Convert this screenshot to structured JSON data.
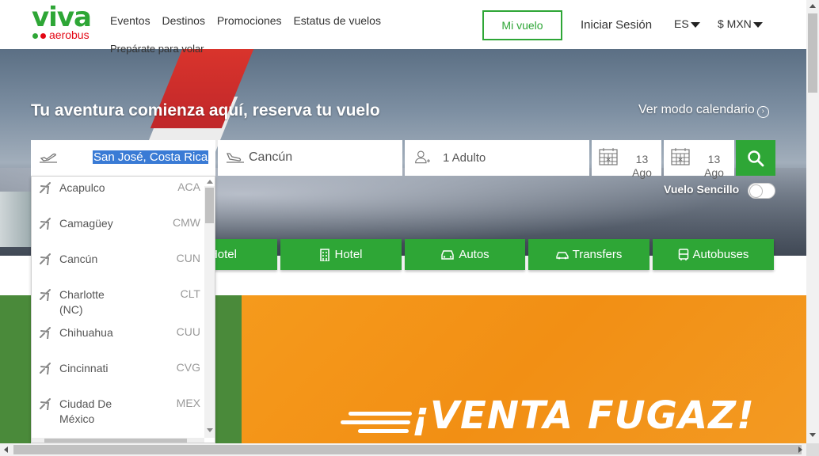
{
  "brand": {
    "name": "viva",
    "sub": "aerobus",
    "green": "#2ea636",
    "red": "#e30613",
    "orange": "#f39a22"
  },
  "nav": {
    "items": [
      "Eventos",
      "Destinos",
      "Promociones",
      "Estatus de vuelos"
    ],
    "second_line": "Prepárate para volar",
    "my_flight": "Mi vuelo",
    "login": "Iniciar Sesión",
    "language": "ES",
    "currency": "$ MXN"
  },
  "hero": {
    "title": "Tu aventura comienza aquí, reserva tu vuelo",
    "calendar_link": "Ver modo calendario",
    "calendar_icon": "chevron-right-circle-icon"
  },
  "search": {
    "origin": "San José, Costa Rica",
    "destination": "Cancún",
    "passengers": "1 Adulto",
    "depart_day": "13",
    "depart_month": "Ago",
    "return_day": "13",
    "return_month": "Ago",
    "one_way_label": "Vuelo Sencillo"
  },
  "products": [
    {
      "label": "+ Hotel",
      "icon": "plane-hotel-icon"
    },
    {
      "label": "Hotel",
      "icon": "building-icon"
    },
    {
      "label": "Autos",
      "icon": "car-icon"
    },
    {
      "label": "Transfers",
      "icon": "shuttle-icon"
    },
    {
      "label": "Autobuses",
      "icon": "bus-icon"
    }
  ],
  "dropdown": {
    "items": [
      {
        "city": "Acapulco",
        "code": "ACA"
      },
      {
        "city": "Camagüey",
        "code": "CMW"
      },
      {
        "city": "Cancún",
        "code": "CUN"
      },
      {
        "city": "Charlotte (NC)",
        "code": "CLT"
      },
      {
        "city": "Chihuahua",
        "code": "CUU"
      },
      {
        "city": "Cincinnati",
        "code": "CVG"
      },
      {
        "city": "Ciudad De México",
        "code": "MEX"
      }
    ]
  },
  "promo": {
    "banner_text": "¡VENTA FUGAZ!"
  }
}
